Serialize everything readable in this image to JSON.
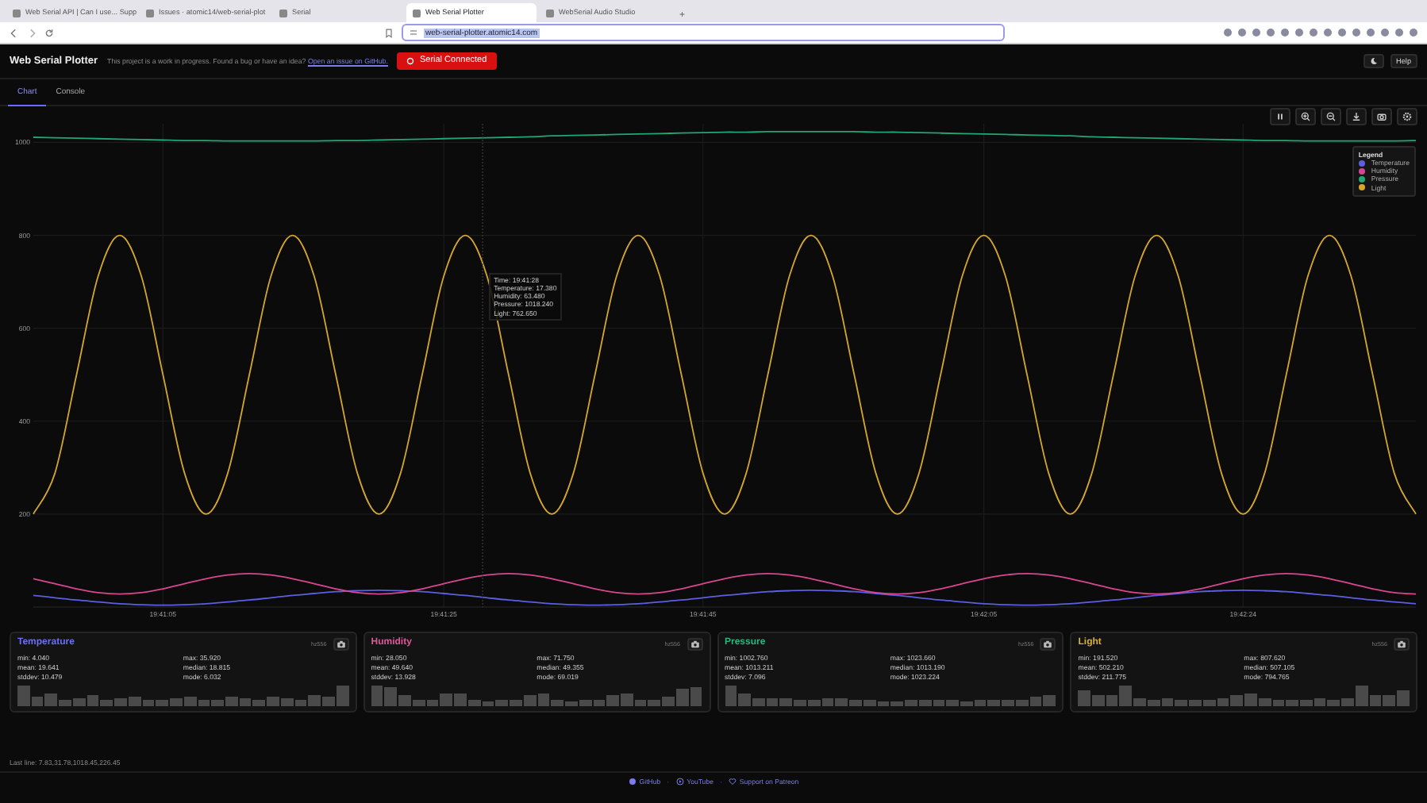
{
  "browser": {
    "tabs": [
      {
        "title": "Web Serial API | Can I use... Supp",
        "selected": false
      },
      {
        "title": "Issues · atomic14/web-serial-plot",
        "selected": false
      },
      {
        "title": "Serial",
        "selected": false
      },
      {
        "title": "Web Serial Plotter",
        "selected": true
      },
      {
        "title": "WebSerial Audio Studio",
        "selected": false
      }
    ],
    "new_tab": "+",
    "url": "web-serial-plotter.atomic14.com"
  },
  "app": {
    "title": "Web Serial Plotter",
    "notice": "This project is a work in progress. Found a bug or have an idea?",
    "notice_link": "Open an issue on GitHub.",
    "connection": {
      "label": "Serial Connected",
      "connected": true
    },
    "help": "Help"
  },
  "tabs": [
    {
      "label": "Chart",
      "selected": true
    },
    {
      "label": "Console",
      "selected": false
    }
  ],
  "chart": {
    "legend_title": "Legend",
    "tooltip": [
      "Time: 19:41:28",
      "Temperature: 17.380",
      "Humidity: 63.480",
      "Pressure: 1018.240",
      "Light: 762.650"
    ],
    "chart_data": {
      "type": "line",
      "ylim": [
        0,
        1040
      ],
      "grid": true,
      "legend": true,
      "yticks": [
        200,
        400,
        600,
        800,
        1000
      ],
      "categories": [
        null,
        null,
        null,
        null,
        null,
        null,
        "19:41:05",
        null,
        null,
        null,
        null,
        null,
        null,
        null,
        null,
        null,
        null,
        null,
        null,
        "19:41:25",
        null,
        null,
        null,
        null,
        null,
        null,
        null,
        null,
        null,
        null,
        null,
        "19:41:45",
        null,
        null,
        null,
        null,
        null,
        null,
        null,
        null,
        null,
        null,
        null,
        null,
        "19:42:05",
        null,
        null,
        null,
        null,
        null,
        null,
        null,
        null,
        null,
        null,
        null,
        "19:42:24",
        null,
        null,
        null,
        null,
        null,
        null,
        null,
        null
      ],
      "series": [
        {
          "name": "Temperature",
          "color": "#5b5fe0",
          "values": [
            25,
            20,
            15,
            11,
            7,
            5,
            4,
            5,
            7,
            11,
            15,
            20,
            25,
            29,
            33,
            35,
            36,
            35,
            33,
            29,
            25,
            20,
            15,
            11,
            7,
            5,
            4,
            5,
            7,
            11,
            15,
            20,
            25,
            29,
            33,
            35,
            36,
            35,
            33,
            29,
            25,
            20,
            15,
            11,
            7,
            5,
            4,
            5,
            7,
            11,
            15,
            20,
            25,
            29,
            33,
            35,
            36,
            35,
            33,
            29,
            25,
            20,
            15,
            11,
            7
          ]
        },
        {
          "name": "Humidity",
          "color": "#d9468f",
          "values": [
            61,
            50,
            39,
            31,
            28,
            31,
            39,
            50,
            61,
            69,
            72,
            69,
            61,
            50,
            39,
            31,
            28,
            31,
            39,
            50,
            61,
            69,
            72,
            69,
            61,
            50,
            39,
            31,
            28,
            31,
            39,
            50,
            61,
            69,
            72,
            69,
            61,
            50,
            39,
            31,
            28,
            31,
            39,
            50,
            61,
            69,
            72,
            69,
            61,
            50,
            39,
            31,
            28,
            31,
            39,
            50,
            61,
            69,
            72,
            69,
            61,
            50,
            39,
            31,
            28
          ]
        },
        {
          "name": "Pressure",
          "color": "#1fa774",
          "values": [
            1011,
            1010,
            1009,
            1008,
            1007,
            1006,
            1005,
            1004,
            1004,
            1003,
            1003,
            1003,
            1003,
            1003,
            1004,
            1004,
            1005,
            1006,
            1007,
            1008,
            1009,
            1010,
            1011,
            1012,
            1014,
            1015,
            1016,
            1017,
            1018,
            1019,
            1020,
            1021,
            1022,
            1022,
            1023,
            1023,
            1023,
            1023,
            1023,
            1022,
            1022,
            1021,
            1020,
            1019,
            1018,
            1017,
            1016,
            1015,
            1014,
            1012,
            1011,
            1010,
            1009,
            1008,
            1007,
            1006,
            1005,
            1004,
            1004,
            1003,
            1003,
            1003,
            1003,
            1003,
            1004
          ]
        },
        {
          "name": "Light",
          "color": "#d4a72c",
          "values": [
            200,
            288,
            500,
            712,
            800,
            712,
            500,
            288,
            200,
            288,
            500,
            712,
            800,
            712,
            500,
            288,
            200,
            288,
            500,
            712,
            800,
            712,
            500,
            288,
            200,
            288,
            500,
            712,
            800,
            712,
            500,
            288,
            200,
            288,
            500,
            712,
            800,
            712,
            500,
            288,
            200,
            288,
            500,
            712,
            800,
            712,
            500,
            288,
            200,
            288,
            500,
            712,
            800,
            712,
            500,
            288,
            200,
            288,
            500,
            712,
            800,
            712,
            500,
            288,
            200
          ]
        }
      ]
    }
  },
  "stats": [
    {
      "name": "Temperature",
      "color": "#6b6ff5",
      "tag": "hz556",
      "rows": [
        "min: 4.040",
        "max: 35.920",
        "mean: 19.641",
        "median: 18.815",
        "stddev: 10.479",
        "mode: 6.032"
      ]
    },
    {
      "name": "Humidity",
      "color": "#e0559b",
      "tag": "hz556",
      "rows": [
        "min: 28.050",
        "max: 71.750",
        "mean: 49.640",
        "median: 49.355",
        "stddev: 13.928",
        "mode: 69.019"
      ]
    },
    {
      "name": "Pressure",
      "color": "#2bb57f",
      "tag": "hz556",
      "rows": [
        "min: 1002.760",
        "max: 1023.660",
        "mean: 1013.211",
        "median: 1013.190",
        "stddev: 7.096",
        "mode: 1023.224"
      ]
    },
    {
      "name": "Light",
      "color": "#d9b03a",
      "tag": "hz556",
      "rows": [
        "min: 191.520",
        "max: 807.620",
        "mean: 502.210",
        "median: 507.105",
        "stddev: 211.775",
        "mode: 794.765"
      ]
    }
  ],
  "last_line": "Last line: 7.83,31.78,1018.45,226.45",
  "footer": [
    {
      "kind": "link",
      "text": "GitHub"
    },
    {
      "kind": "separator",
      "text": "·"
    },
    {
      "kind": "link",
      "text": "YouTube"
    },
    {
      "kind": "separator",
      "text": "·"
    },
    {
      "kind": "link",
      "text": "Support on Patreon"
    }
  ]
}
